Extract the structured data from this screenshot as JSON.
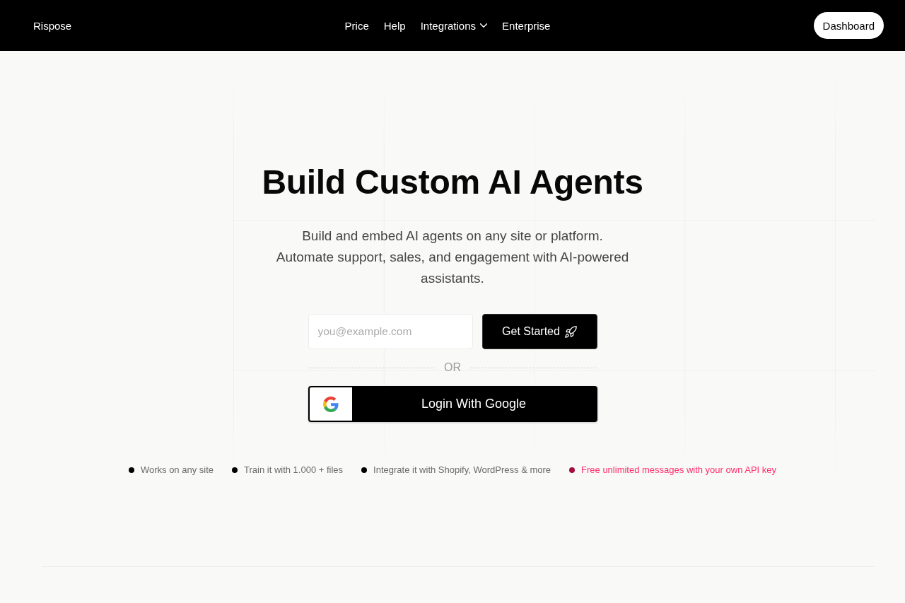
{
  "navbar": {
    "logo": "Rispose",
    "links": [
      {
        "label": "Price",
        "kind": "link"
      },
      {
        "label": "Help",
        "kind": "link"
      },
      {
        "label": "Integrations",
        "kind": "dropdown"
      },
      {
        "label": "Enterprise",
        "kind": "link"
      }
    ],
    "button": "Dashboard"
  },
  "hero": {
    "title": "Build Custom AI Agents",
    "subtitle": [
      "Build and embed AI agents on any site or platform.",
      "Automate support, sales, and engagement with AI-powered assistants."
    ]
  },
  "signup": {
    "email": {
      "placeholder": "you@example.com"
    },
    "submit": "Get Started",
    "divider": "OR",
    "google_button": "Login With Google"
  },
  "features": [
    {
      "text": "Works on any site",
      "color": "#000000",
      "highlighted": false
    },
    {
      "text": "Train it with 1.000 + files",
      "color": "#000000",
      "highlighted": false
    },
    {
      "text": "Integrate it with Shopify, WordPress & more",
      "color": "#000000",
      "highlighted": false
    },
    {
      "text": "Free unlimited messages with your own API key",
      "color": "#a50d3e",
      "highlighted": true
    }
  ]
}
